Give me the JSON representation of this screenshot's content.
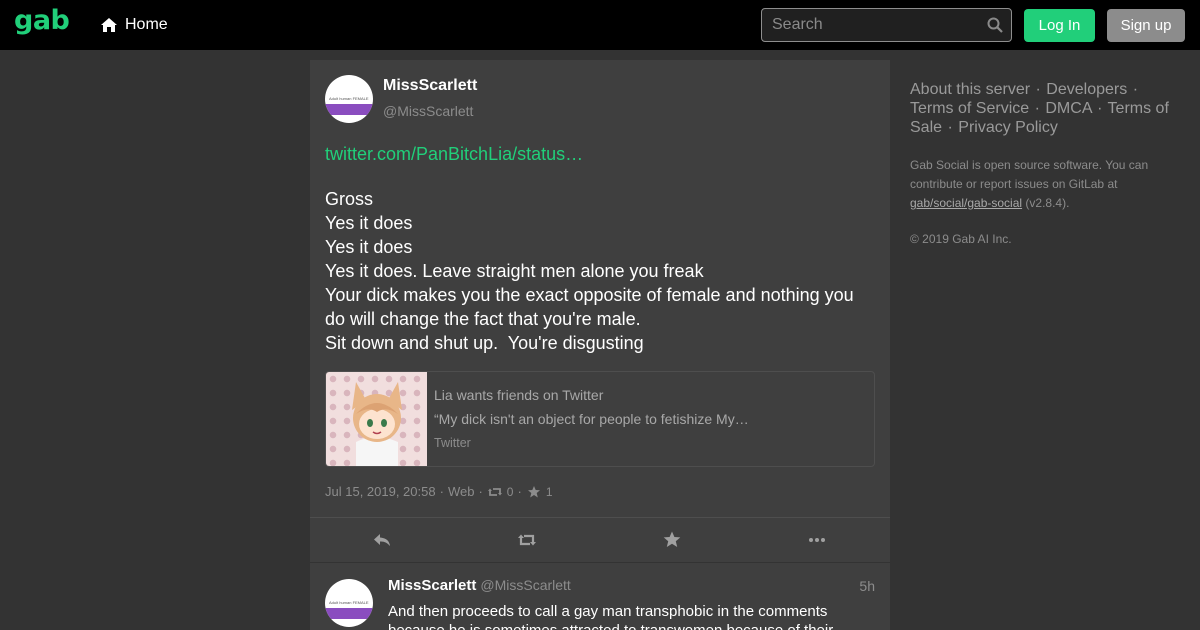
{
  "header": {
    "logo": "gab",
    "home_label": "Home",
    "search_placeholder": "Search",
    "login_label": "Log In",
    "signup_label": "Sign up"
  },
  "status": {
    "display_name": "MissScarlett",
    "account": "@MissScarlett",
    "avatar_text": "Adult human FEMALE",
    "link_text": "twitter.com/PanBitchLia/status…",
    "content_lines": [
      "Gross",
      "Yes it does",
      "Yes it does",
      "Yes it does. Leave straight men alone you freak",
      "Your dick makes you the exact opposite of female and nothing you do will change the fact that you're male.",
      "Sit down and shut up.  You're disgusting"
    ],
    "card": {
      "title": "Lia wants friends on Twitter",
      "description": "“My dick isn't an object for people to fetishize My…",
      "provider": "Twitter"
    },
    "meta": {
      "timestamp": "Jul 15, 2019, 20:58",
      "application": "Web",
      "reblogs": "0",
      "favourites": "1",
      "separator": "·"
    }
  },
  "reply": {
    "display_name": "MissScarlett",
    "account": "@MissScarlett",
    "time": "5h",
    "text": "And then proceeds to call a gay man transphobic in the comments because he is sometimes attracted to transwomen because of their"
  },
  "sidebar": {
    "links": [
      "About this server",
      "Developers",
      "Terms of Service",
      "DMCA",
      "Terms of Sale",
      "Privacy Policy"
    ],
    "note_prefix": "Gab Social is open source software. You can contribute or report issues on GitLab at ",
    "repo_link": "gab/social/gab-social",
    "version": " (v2.8.4).",
    "copyright": "© 2019 Gab AI Inc."
  },
  "colors": {
    "accent": "#21cf7a",
    "background": "#333333",
    "panel": "#3f3f3f",
    "muted": "#8c8c8c"
  },
  "icons": [
    "home-icon",
    "search-icon",
    "reply-icon",
    "boost-icon",
    "star-icon",
    "more-icon"
  ]
}
